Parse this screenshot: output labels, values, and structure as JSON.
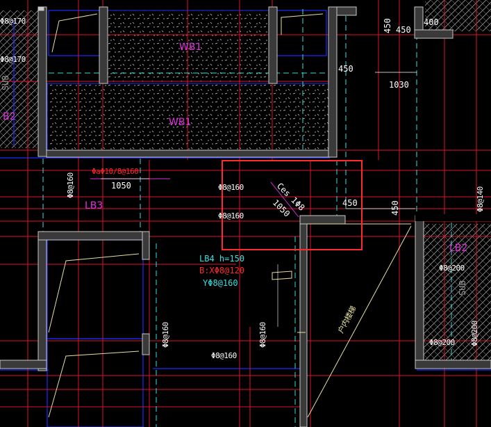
{
  "colors": {
    "background": "#000000",
    "wall_fill": "#3a3a3a",
    "wall_edge": "#c8c8c8",
    "axis_red": "#e0102a",
    "dash_cyan": "#35e0e0",
    "blue_outline": "#1b2cff",
    "yellow": "#e8e0a0",
    "magenta": "#e030e0",
    "white_text": "#ffffff",
    "highlight": "#ff2a2a"
  },
  "labels": {
    "wb1_top": "WB1",
    "wb1_mid": "WB1",
    "lb3": "LB3",
    "lb2": "LB2",
    "lb2_left": "B2",
    "lb4_title": "LB4  h=150",
    "lb4_bx": "B:XΦ8@120",
    "lb4_y": "YΦ8@160",
    "leader_note": "ΦaΦ10/8@160",
    "ces_note": "Ces 1Φ8",
    "stair_note": "户内楼梯",
    "sub_top": "SUB",
    "sub_right": "SUB"
  },
  "dimensions": {
    "d450_a": "450",
    "d450_b": "450",
    "d400": "400",
    "d450_c": "450",
    "d1030": "1030",
    "d1050_left": "1050",
    "d1050_diag": "1050",
    "d450_d": "450",
    "d450_e": "450"
  },
  "rebar": {
    "r_top1": "Φ8@170",
    "r_top2": "Φ8@170",
    "r_v160_a": "Φ8@160",
    "r_c160_1": "Φ8@160",
    "r_c160_2": "Φ8@160",
    "r_v140": "Φ8@140",
    "r_200_1": "Φ8@200",
    "r_200_2": "Φ8@200",
    "r_v200": "Φ8@200",
    "r_v160_b": "Φ8@160",
    "r_v160_c": "Φ8@160",
    "r_b160": "Φ8@160"
  }
}
